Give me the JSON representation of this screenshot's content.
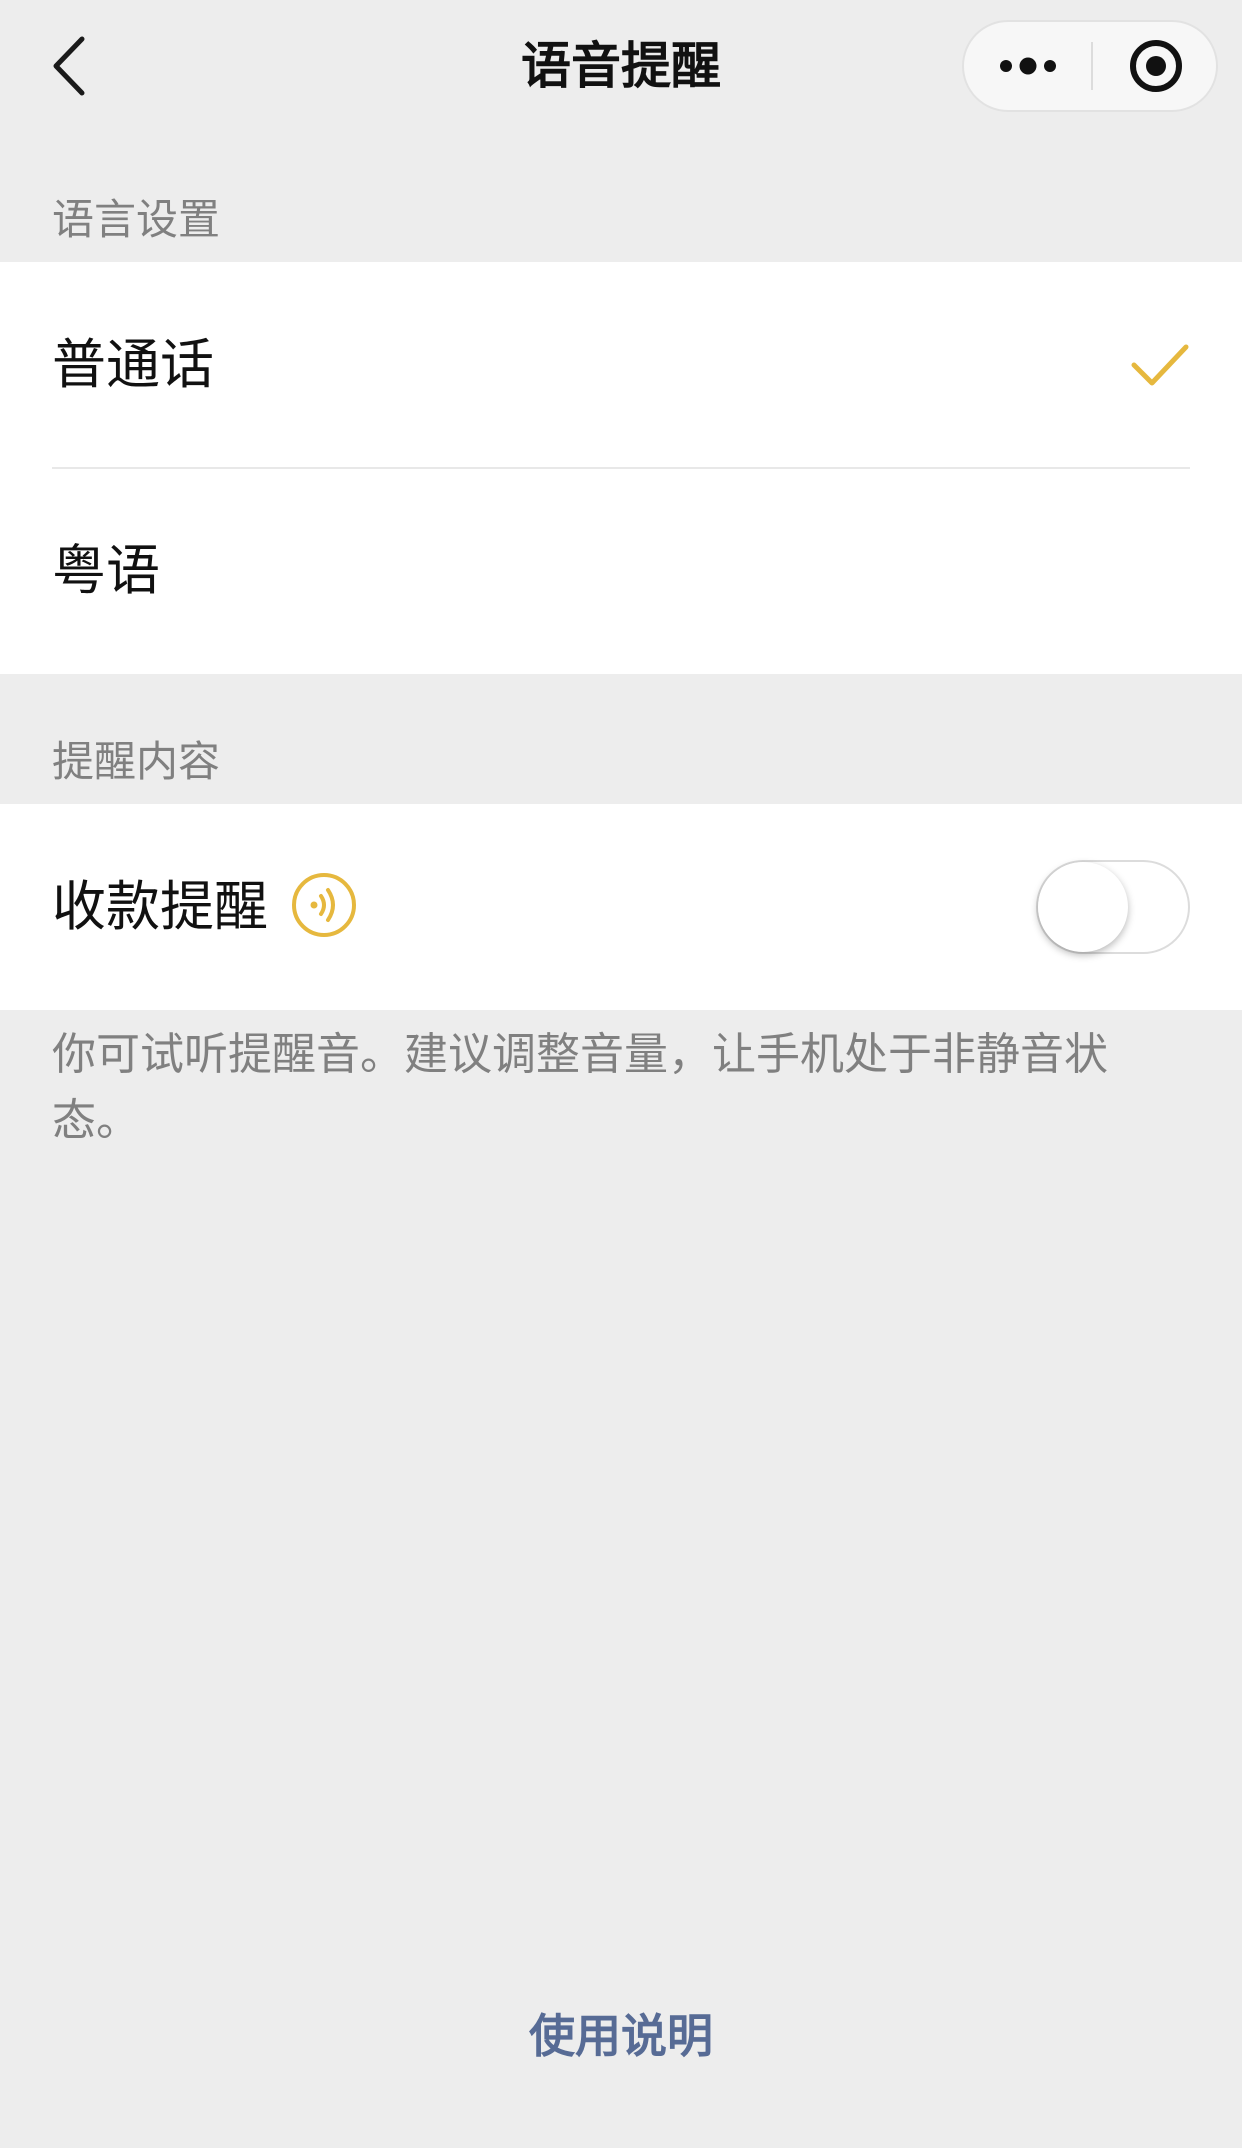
{
  "nav": {
    "title": "语音提醒",
    "back_icon": "chevron-left-icon",
    "more_icon": "more-dots-icon",
    "close_icon": "target-circle-icon"
  },
  "language_section": {
    "header": "语言设置",
    "options": [
      {
        "label": "普通话",
        "selected": true
      },
      {
        "label": "粤语",
        "selected": false
      }
    ]
  },
  "content_section": {
    "header": "提醒内容",
    "payment_reminder": {
      "label": "收款提醒",
      "preview_icon": "sound-wave-icon",
      "enabled": false
    }
  },
  "hint": "你可试听提醒音。建议调整音量，让手机处于非静音状态。",
  "footer": {
    "link": "使用说明"
  },
  "colors": {
    "accent": "#e6b83e",
    "link": "#576b95",
    "background": "#ededed"
  }
}
